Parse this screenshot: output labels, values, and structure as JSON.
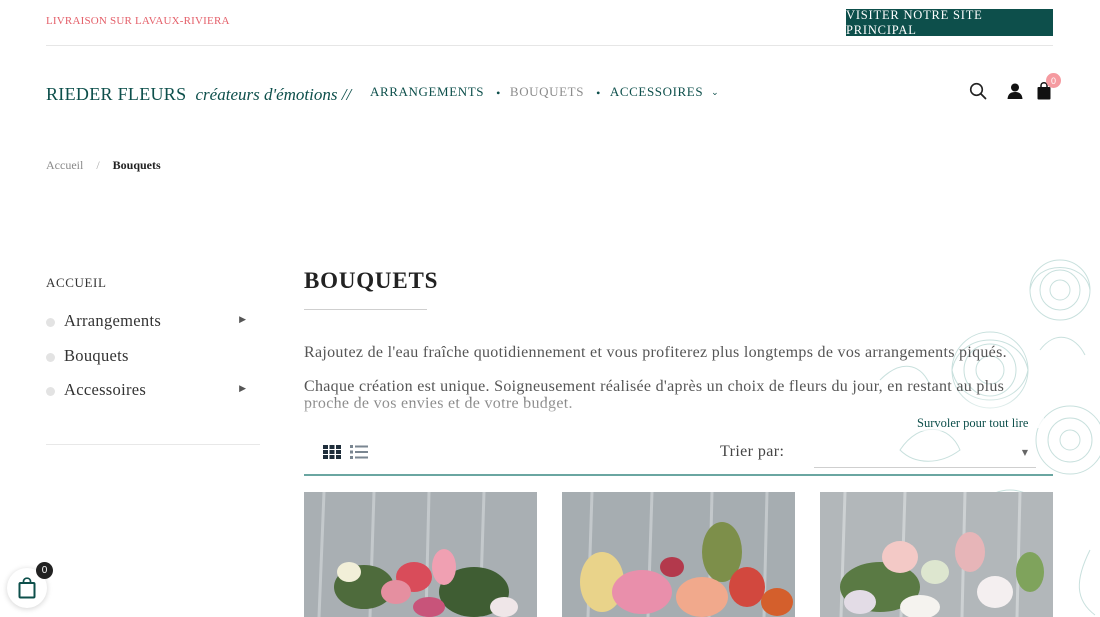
{
  "topbar": {
    "delivery_text": "LIVRAISON SUR LAVAUX-RIVIERA",
    "main_site_button": "VISITER NOTRE SITE PRINCIPAL"
  },
  "header": {
    "logo_brand": "RIEDER FLEURS",
    "logo_tagline": "créateurs d'émotions //",
    "nav": [
      {
        "label": "ARRANGEMENTS"
      },
      {
        "label": "BOUQUETS"
      },
      {
        "label": "ACCESSOIRES"
      }
    ],
    "icons": [
      "search-icon",
      "user-icon",
      "shopping-bag-icon"
    ],
    "cart_count": "0"
  },
  "breadcrumb": {
    "home": "Accueil",
    "separator": "/",
    "current": "Bouquets"
  },
  "sidebar": {
    "title": "ACCUEIL",
    "items": [
      {
        "label": "Arrangements"
      },
      {
        "label": "Bouquets"
      },
      {
        "label": "Accessoires"
      }
    ]
  },
  "main": {
    "title": "BOUQUETS",
    "description": [
      "Rajoutez de l'eau fraîche quotidiennement et vous profiterez plus longtemps de vos arrangements piqués.",
      "Chaque création est unique. Soigneusement réalisée d'après un choix de fleurs du jour, en restant au plus proche de vos envies et de votre budget."
    ],
    "read_more": "Survoler pour tout lire",
    "sort_label": "Trier par:",
    "sort_value": ""
  },
  "floating_cart": {
    "count": "0"
  },
  "colors": {
    "brand": "#0d4f4b",
    "accent_pink": "#e4606a",
    "badge_pink": "#f59aa0",
    "toolbar_line": "#6aa6a1"
  }
}
